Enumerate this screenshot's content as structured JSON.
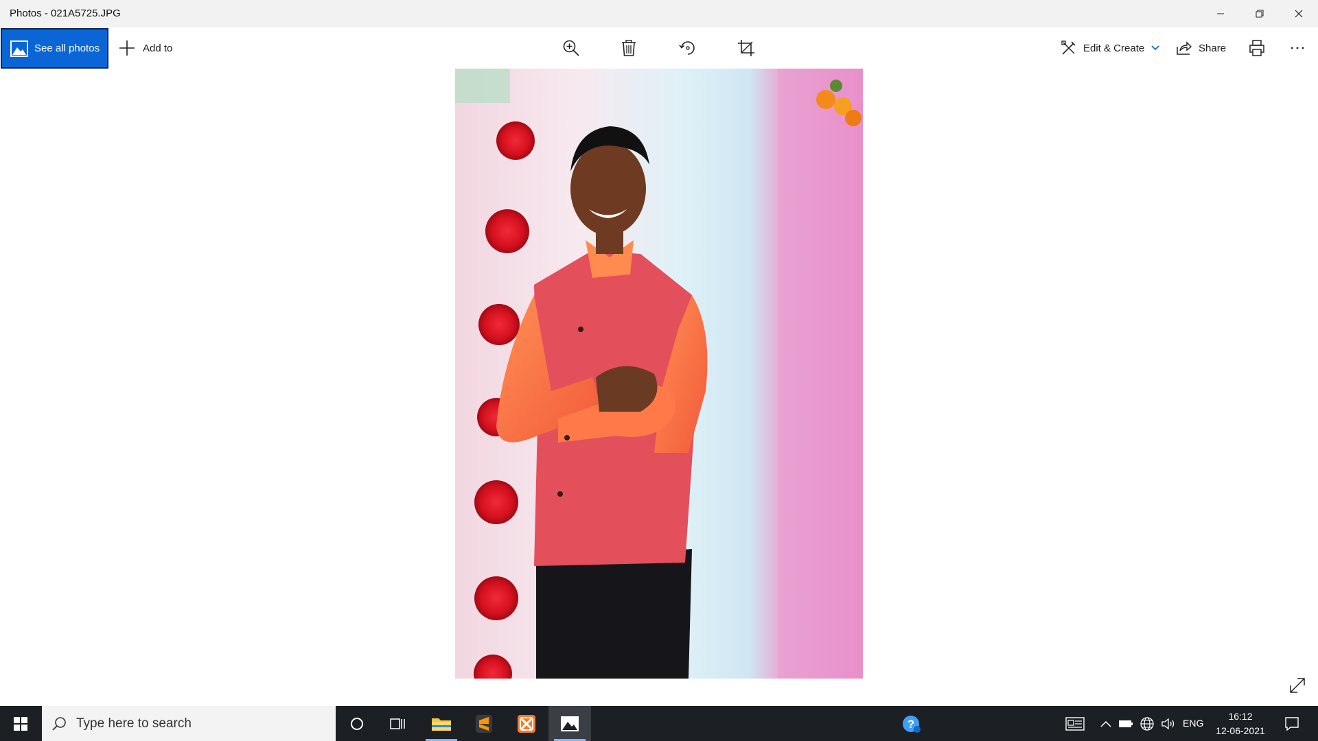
{
  "window": {
    "title": "Photos - 021A5725.JPG",
    "controls": [
      "minimize-icon",
      "restore-icon",
      "close-icon"
    ]
  },
  "toolbar": {
    "see_all_label": "See all photos",
    "add_to_label": "Add to",
    "center_icons": [
      "zoom-in-icon",
      "delete-icon",
      "rotate-icon",
      "crop-icon"
    ],
    "edit_create_label": "Edit & Create",
    "share_label": "Share",
    "right_icons": [
      "print-icon",
      "more-icon"
    ]
  },
  "taskbar": {
    "search_placeholder": "Type here to search",
    "apps": [
      "cortana-icon",
      "task-view-icon",
      "file-explorer-icon",
      "sublime-text-icon",
      "xampp-icon",
      "photos-app-icon"
    ],
    "tray": {
      "language": "ENG",
      "time": "16:12",
      "date": "12-06-2021"
    }
  },
  "colors": {
    "accent": "#0a66d6",
    "taskbar": "#1c1f24",
    "titlebar": "#f2f2f2"
  }
}
